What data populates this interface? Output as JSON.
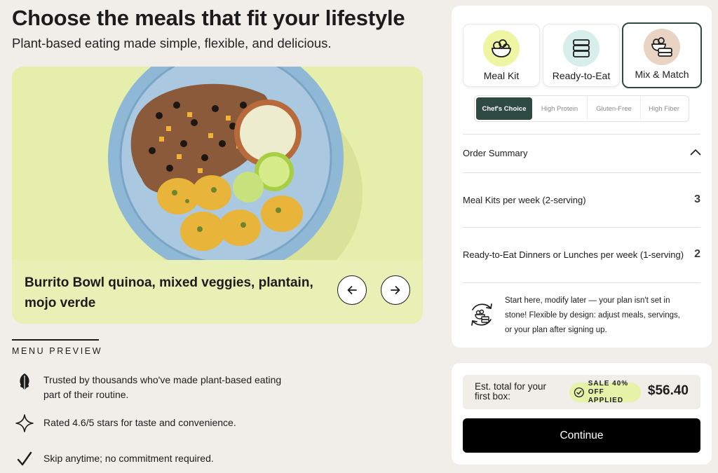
{
  "header": {
    "title": "Choose the meals that fit your lifestyle",
    "subtitle": "Plant-based eating made simple, flexible, and delicious."
  },
  "carousel": {
    "caption_line1": "Burrito Bowl quinoa, mixed veggies, plantain,",
    "caption_line2": "mojo verde"
  },
  "menu_preview": {
    "label": "MENU PREVIEW",
    "features": [
      {
        "icon": "kale-leaf-icon",
        "line1": "Trusted by thousands who've made plant-based eating",
        "line2": "part of their routine."
      },
      {
        "icon": "sparkle-star-icon",
        "line1": "Rated 4.6/5 stars for taste and convenience.",
        "line2": ""
      },
      {
        "icon": "checkmark-icon",
        "line1": "Skip anytime; no commitment required.",
        "line2": ""
      }
    ]
  },
  "plans": [
    {
      "label": "Meal Kit",
      "icon": "bowl-icon",
      "circle_color": "#eef5a3",
      "selected": false
    },
    {
      "label": "Ready-to-Eat",
      "icon": "container-stack-icon",
      "circle_color": "#d8eeea",
      "selected": false
    },
    {
      "label": "Mix & Match",
      "icon": "bowl-and-container-icon",
      "circle_color": "#e9d4c4",
      "selected": true
    }
  ],
  "filters": [
    "Chef's Choice",
    "High Protein",
    "Gluten-Free",
    "High Fiber"
  ],
  "active_filter": "Chef's Choice",
  "order_summary": {
    "title": "Order Summary",
    "rows": [
      {
        "label": "Meal Kits per week (2-serving)",
        "value": "3"
      },
      {
        "label": "Ready-to-Eat Dinners or Lunches per week (1-serving)",
        "value": "2"
      }
    ],
    "note_line1": "Start here, modify later — your plan isn't set in",
    "note_line2": "stone! Flexible by design: adjust meals, servings,",
    "note_line3": "or your plan after signing up."
  },
  "checkout": {
    "total_label_line1": "Est. total for your",
    "total_label_line2": "first box:",
    "sale_line1": "SALE 40%",
    "sale_line2": "OFF APPLIED",
    "total_price": "$56.40",
    "continue_label": "Continue"
  },
  "colors": {
    "page_bg": "#f1ede9",
    "accent_dark_green": "#2f4a42",
    "hero_bg": "#e9f0b5",
    "sale_badge_bg": "#e6f2a8"
  }
}
